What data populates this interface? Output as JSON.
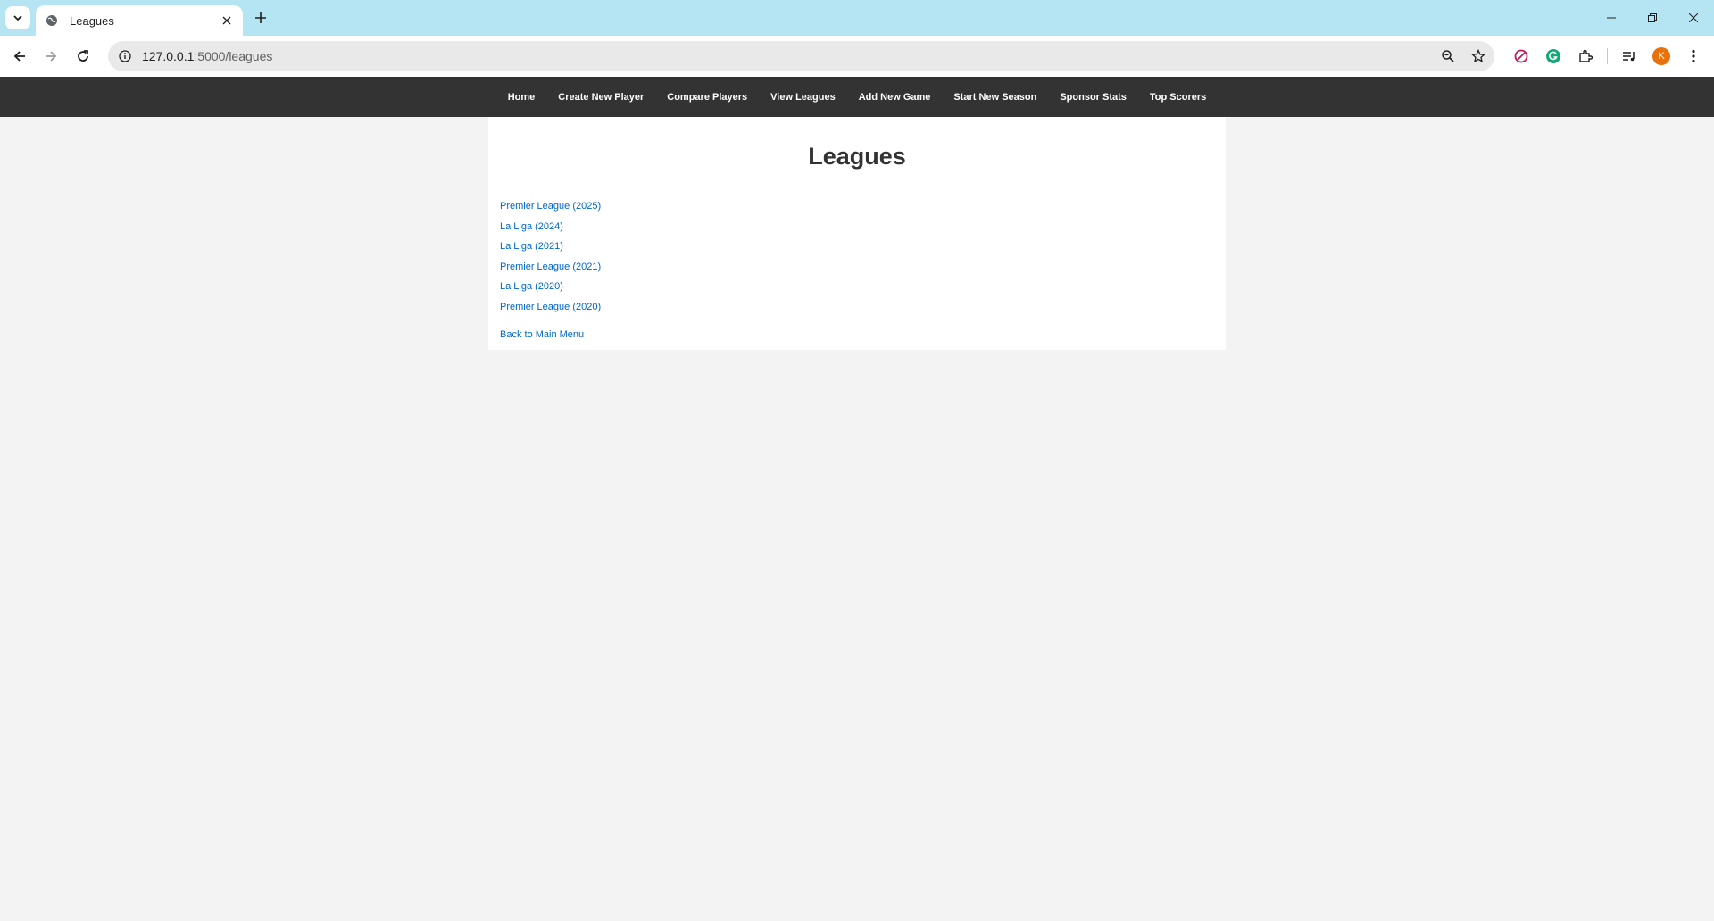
{
  "browser": {
    "tab_title": "Leagues",
    "url_host": "127.0.0.1",
    "url_path": ":5000/leagues",
    "avatar_letter": "K"
  },
  "nav": {
    "items": [
      "Home",
      "Create New Player",
      "Compare Players",
      "View Leagues",
      "Add New Game",
      "Start New Season",
      "Sponsor Stats",
      "Top Scorers"
    ]
  },
  "page": {
    "title": "Leagues",
    "leagues": [
      "Premier League (2025)",
      "La Liga (2024)",
      "La Liga (2021)",
      "Premier League (2021)",
      "La Liga (2020)",
      "Premier League (2020)"
    ],
    "back_link": "Back to Main Menu"
  },
  "colors": {
    "tabstrip": "#b5e5f2",
    "navbar": "#333333",
    "link": "#0066cc",
    "background": "#f3f3f3"
  }
}
